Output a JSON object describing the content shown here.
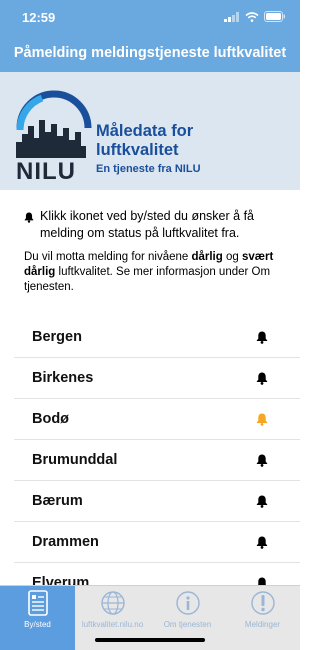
{
  "status": {
    "time": "12:59"
  },
  "header": {
    "title": "Påmelding meldingstjeneste luftkvalitet"
  },
  "banner": {
    "logo_text": "NILU",
    "title_line1": "Måledata for",
    "title_line2": "luftkvalitet",
    "subtitle": "En tjeneste fra NILU"
  },
  "info": {
    "instruction": "Klikk ikonet ved by/sted du ønsker å få melding om status på luftkvalitet fra."
  },
  "note": {
    "part1": "Du vil motta melding for nivåene ",
    "bold1": "dårlig",
    "part2": " og ",
    "bold2": "svært dårlig",
    "part3": " luftkvalitet. Se mer informasjon under Om tjenesten."
  },
  "places": [
    {
      "name": "Bergen",
      "bell": "bell-icon",
      "active": false
    },
    {
      "name": "Birkenes",
      "bell": "bell-icon",
      "active": false
    },
    {
      "name": "Bodø",
      "bell": "bell-icon",
      "active": true
    },
    {
      "name": "Brumunddal",
      "bell": "bell-icon",
      "active": false
    },
    {
      "name": "Bærum",
      "bell": "bell-icon",
      "active": false
    },
    {
      "name": "Drammen",
      "bell": "bell-icon",
      "active": false
    },
    {
      "name": "Elverum",
      "bell": "bell-icon",
      "active": false
    }
  ],
  "tabs": [
    {
      "label": "By/sted",
      "icon": "list-icon",
      "active": true
    },
    {
      "label": "luftkvalitet.nilu.no",
      "icon": "globe-icon",
      "active": false
    },
    {
      "label": "Om tjenesten",
      "icon": "info-icon",
      "active": false
    },
    {
      "label": "Meldinger",
      "icon": "exclamation-icon",
      "active": false
    }
  ],
  "colors": {
    "header": "#6aa8e0",
    "banner_bg": "#dce6f1",
    "brand_blue": "#1a4f9b",
    "bell_active": "#f5a623",
    "bell_inactive": "#000000",
    "tab_active": "#5c9de0"
  }
}
